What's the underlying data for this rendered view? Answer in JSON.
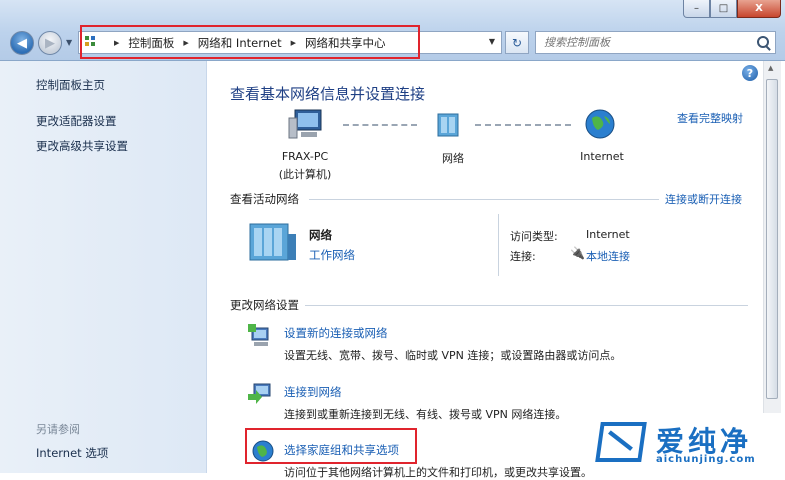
{
  "window": {
    "controls": [
      "–",
      "□",
      "X"
    ]
  },
  "nav": {
    "back_glyph": "◀",
    "forward_glyph": "▶",
    "refresh_glyph": "↻"
  },
  "address": {
    "breadcrumbs": [
      "控制面板",
      "网络和 Internet",
      "网络和共享中心"
    ]
  },
  "search": {
    "placeholder": "搜索控制面板"
  },
  "sidebar": {
    "items": [
      "控制面板主页",
      "更改适配器设置",
      "更改高级共享设置"
    ],
    "see_also_heading": "另请参阅",
    "see_also_items": [
      "Internet 选项"
    ]
  },
  "main": {
    "help_glyph": "?",
    "title": "查看基本网络信息并设置连接",
    "view_full_map": "查看完整映射",
    "network_map": {
      "computer_name": "FRAX-PC",
      "computer_sub": "(此计算机)",
      "network": "网络",
      "internet": "Internet"
    },
    "active_networks": {
      "heading": "查看活动网络",
      "connect_link": "连接或断开连接",
      "network_name": "网络",
      "network_type": "工作网络",
      "access_type_label": "访问类型:",
      "access_type_value": "Internet",
      "connections_label": "连接:",
      "connections_value": "本地连接"
    },
    "change_settings": {
      "heading": "更改网络设置",
      "tasks": [
        {
          "title": "设置新的连接或网络",
          "desc": "设置无线、宽带、拨号、临时或 VPN 连接；或设置路由器或访问点。"
        },
        {
          "title": "连接到网络",
          "desc": "连接到或重新连接到无线、有线、拨号或 VPN 网络连接。"
        },
        {
          "title": "选择家庭组和共享选项",
          "desc": "访问位于其他网络计算机上的文件和打印机，或更改共享设置。"
        }
      ]
    }
  },
  "watermark": {
    "text": "爱纯净",
    "url": "aichunjing.com"
  },
  "colors": {
    "highlight_box": "#e0242d",
    "link": "#1a5fb4",
    "title": "#1e3f84"
  }
}
